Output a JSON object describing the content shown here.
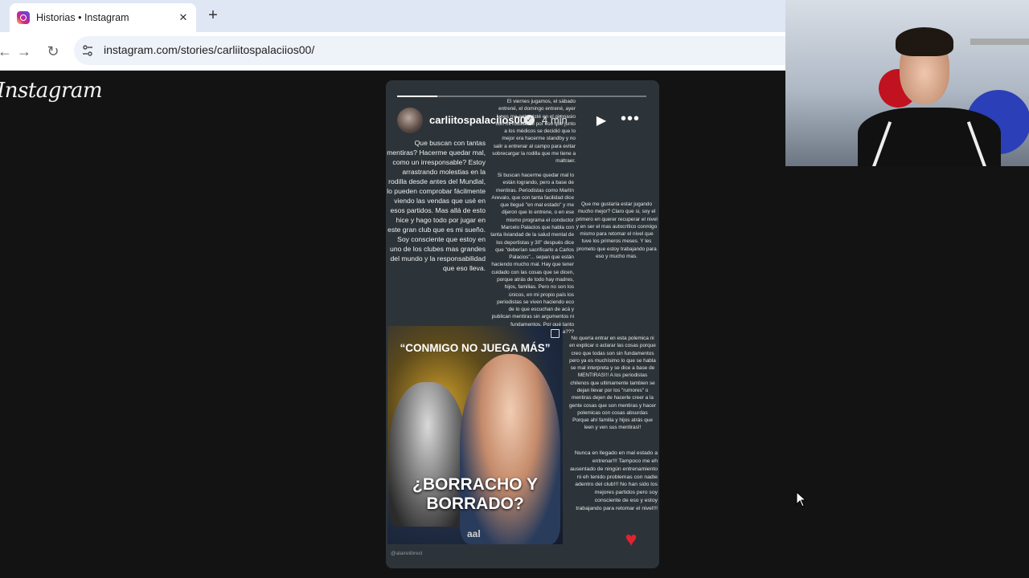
{
  "browser": {
    "tab_title": "Historias • Instagram",
    "tab_close": "✕",
    "new_tab": "+",
    "url": "instagram.com/stories/carliitospalaciios00/",
    "back": "←",
    "forward": "→",
    "reload": "↻"
  },
  "instagram": {
    "logo": "Instagram"
  },
  "story": {
    "username": "carliitospalaciios00",
    "time": "4 min",
    "progress": 0.16,
    "text_blocks": {
      "top_middle": "El viernes jugamos, el sábado entrené, el domingo entrené, ayer lunes me entrevisté en el gimnasio con mi rodilla. Lo por eso que junto a los médicos se decidió que lo mejor era hacerme standby y no salir a entrenar al campo para evitar sobrecargar la rodilla que me tiene a maltraer.",
      "left": "Que buscan con tantas mentiras? Hacerme quedar mal, como un irresponsable? Estoy arrastrando molestias en la rodilla desde antes del Mundial, lo pueden comprobar fácilmente viendo las vendas que usé en esos partidos. Mas allá de esto hice y hago todo por jugar en este gran club que es mi sueño. Soy consciente que estoy en uno de los clubes mas grandes del mundo y la responsabilidad que eso lleva.",
      "middle": "Si buscan hacerme quedar mal lo están logrando, pero a base de mentiras. Periodistas como Martín Arevalo, que con tanta facilidad dice que llegué \"en mal estado\" y me dijeron que lo entrene, o en ese mismo programa el conductor Marcelo Palacios que habla con tanta liviandad de la salud mental de los deportistas y 30\" después dice que \"deberían sacrificarlo a Carlos Palacios\"... sepan que están haciendo mucho mal. Hay que tener cuidado con las cosas que se dicen, porque atrás de todo hay madres, hijos, familias. Pero no son los únicos, en mi propio país los periodistas se viven haciendo eco de lo que escuchan de acá y publican mentiras sin argumentos ni fundamentos. Por qué tanto hostigamiento hacia mi persona???",
      "right": "Que me gustaría estar jugando mucho mejor? Claro que si, soy el primero en querer recuperar el nivel y en ser el mas autocrítico conmigo mismo para retomar el nivel que tuve los primeros meses. Y les prometo que estoy trabajando para eso y mucho mas.",
      "right_lower": "No quería entrar en esta polemica ni en explicar o aclarar las cosas porque creo que todas son sin fundamentos pero ya es muchísimo lo que se habla se mal interpreta y se dice a base de MENTIRAS!!! A los periodistas chilenos que ultimamente tambien se dejan llevar por los \"rumores\" o mentiras dejen de hacerle creer a la gente cosas que son mentiras y hacer polemicas con cosas absurdas Porque ahí familia y hijos atrás que leen y ven sus mentiras!!",
      "right_bottom": "Nunca en llegado en mal estado a entrenar!!! Tampoco me eh ausentado de ningún entrenamiento ni eh tenido problemas con nadie adentro del club!!! No han sido los mejores partidos pero soy consciente de eso y estoy trabajando para retomar el nivel!!!"
    },
    "article": {
      "quote": "“CONMIGO NO JUEGA MÁS”",
      "headline_line1": "¿BORRACHO Y",
      "headline_line2": "BORRADO?",
      "logo": "aal"
    },
    "watermark": "@alairelibrecl",
    "heart_icon": "♥",
    "play_icon": "▶",
    "more_icon": "•••",
    "verified_icon": "✓"
  }
}
